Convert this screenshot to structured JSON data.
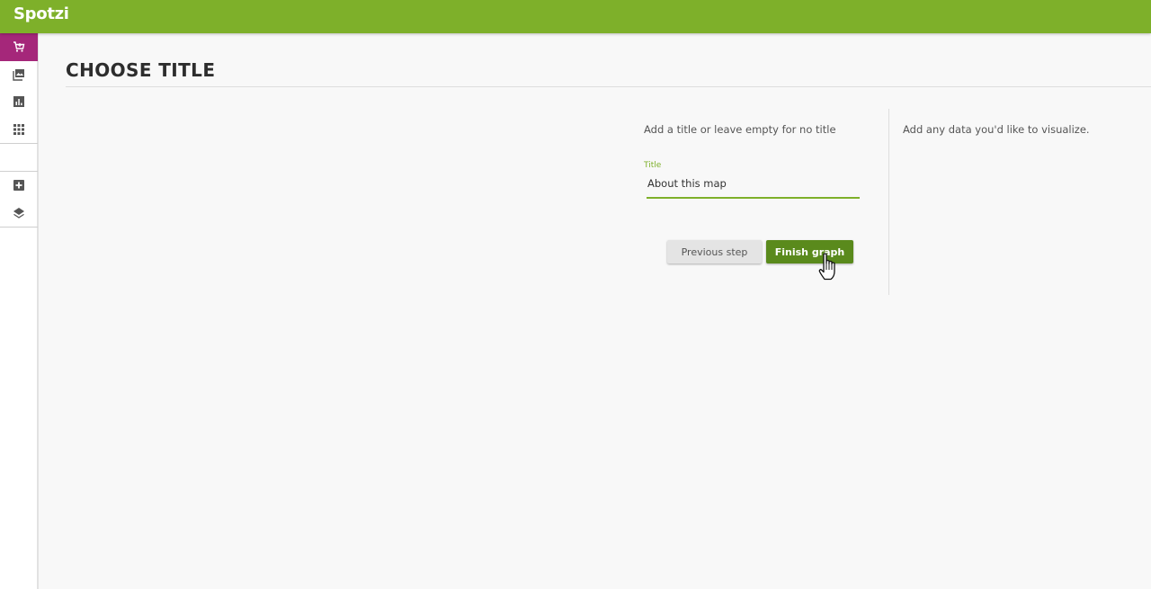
{
  "app": {
    "logo_text": "Spotzi",
    "brand_color": "#7eb02a",
    "active_color": "#a5277a"
  },
  "sidebar": {
    "items": [
      {
        "icon": "cart-icon",
        "active": true
      },
      {
        "icon": "gallery-icon",
        "active": false
      },
      {
        "icon": "chart-icon",
        "active": false
      },
      {
        "icon": "grid-icon",
        "active": false
      },
      {
        "icon": "add-box-icon",
        "active": false
      },
      {
        "icon": "layers-icon",
        "active": false
      }
    ]
  },
  "main": {
    "page_title": "CHOOSE TITLE",
    "instruction": "Add a title or leave empty for no title",
    "title_field": {
      "label": "Title",
      "value": "About this map"
    },
    "buttons": {
      "previous": "Previous step",
      "finish": "Finish graph"
    },
    "right_panel_text": "Add any data you'd like to visualize."
  }
}
